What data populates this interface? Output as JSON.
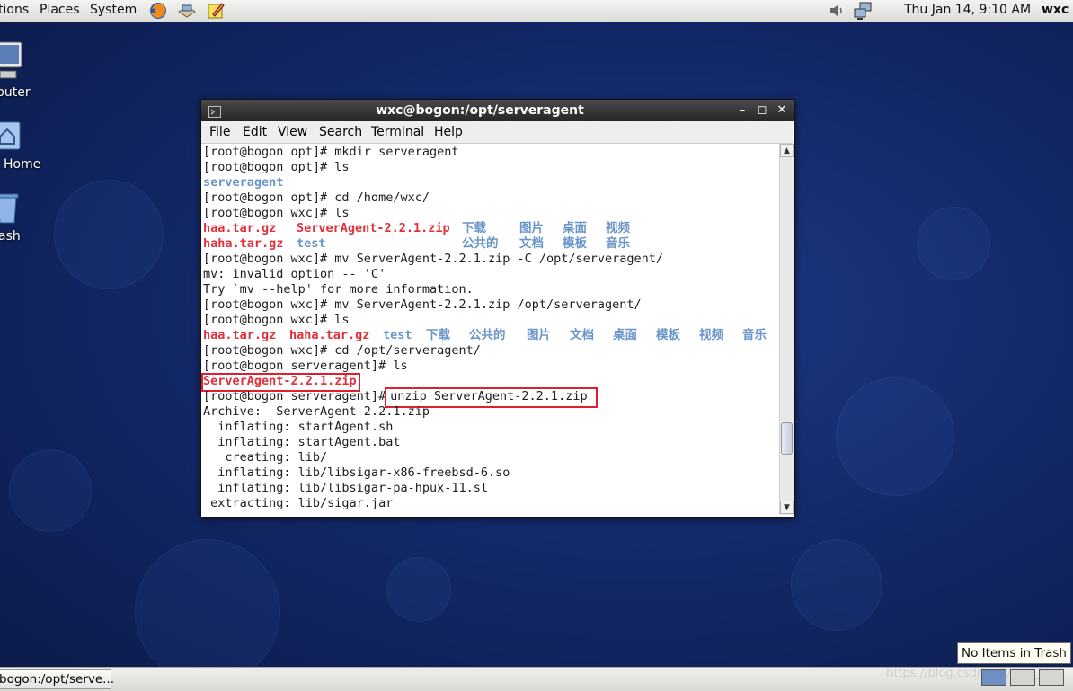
{
  "top_panel": {
    "menus": [
      "Applications",
      "Places",
      "System"
    ],
    "menu_visible": [
      "tions",
      "Places",
      "System"
    ],
    "launchers": [
      "firefox-icon",
      "mail-icon",
      "notes-icon"
    ],
    "clock": "Thu Jan 14,  9:10 AM",
    "user": "wxc"
  },
  "desktop_icons": [
    {
      "label": "puter",
      "icon": "computer-icon"
    },
    {
      "label": "Home",
      "icon": "home-folder-icon"
    },
    {
      "label": "ash",
      "icon": "trash-icon"
    }
  ],
  "window": {
    "title": "wxc@bogon:/opt/serveragent",
    "menus": [
      "File",
      "Edit",
      "View",
      "Search",
      "Terminal",
      "Help"
    ],
    "terminal_lines": [
      "[root@bogon opt]# mkdir serveragent",
      "[root@bogon opt]# ls",
      "serveragent",
      "[root@bogon opt]# cd /home/wxc/",
      "[root@bogon wxc]# ls",
      "haa.tar.gz   ServerAgent-2.2.1.zip  下载    图片  桌面  视频",
      "haha.tar.gz  test                   公共的  文档  模板  音乐",
      "[root@bogon wxc]# mv ServerAgent-2.2.1.zip -C /opt/serveragent/",
      "mv: invalid option -- 'C'",
      "Try `mv --help' for more information.",
      "[root@bogon wxc]# mv ServerAgent-2.2.1.zip /opt/serveragent/",
      "[root@bogon wxc]# ls",
      "haa.tar.gz  haha.tar.gz  test  下载  公共的  图片  文档  桌面  模板  视频  音乐",
      "[root@bogon wxc]# cd /opt/serveragent/",
      "[root@bogon serveragent]# ls",
      "ServerAgent-2.2.1.zip",
      "[root@bogon serveragent]# unzip ServerAgent-2.2.1.zip",
      "Archive:  ServerAgent-2.2.1.zip",
      "  inflating: startAgent.sh",
      "  inflating: startAgent.bat",
      "   creating: lib/",
      "  inflating: lib/libsigar-x86-freebsd-6.so",
      "  inflating: lib/libsigar-pa-hpux-11.sl",
      " extracting: lib/sigar.jar"
    ],
    "tokens": {
      "l3": "serveragent",
      "l6a": "haa.tar.gz",
      "l6b": "ServerAgent-2.2.1.zip",
      "l6c": [
        "下载",
        "图片",
        "桌面",
        "视频"
      ],
      "l7a": "haha.tar.gz",
      "l7b": "test",
      "l7c": [
        "公共的",
        "文档",
        "模板",
        "音乐"
      ],
      "l13a": "haa.tar.gz",
      "l13b": "haha.tar.gz",
      "l13c": [
        "test",
        "下载",
        "公共的",
        "图片",
        "文档",
        "桌面",
        "模板",
        "视频",
        "音乐"
      ],
      "l16": "ServerAgent-2.2.1.zip",
      "l17_prompt": "[root@bogon serveragent]#",
      "l17_cmd": " unzip ServerAgent-2.2.1.zip"
    },
    "highlight_color": "#e02030"
  },
  "bottom_panel": {
    "task_button": "bogon:/opt/serve...",
    "trash_tooltip": "No Items in Trash",
    "watermark": "https://blog.csdn.net/wxc_la"
  },
  "colors": {
    "archive_red": "#e0303a",
    "dir_blue": "#6a95c8",
    "desktop_blue": "#13296a"
  }
}
